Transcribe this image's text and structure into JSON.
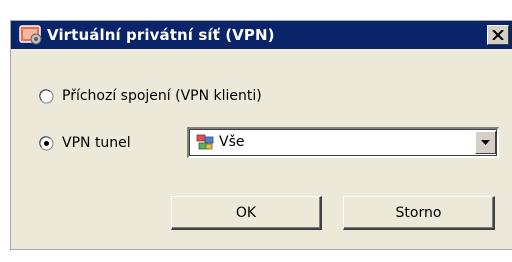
{
  "dialog": {
    "title": "Virtuální privátní síť (VPN)",
    "close_label": "×"
  },
  "options": {
    "incoming_label": "Příchozí spojení (VPN klienti)",
    "incoming_selected": false,
    "tunnel_label": "VPN tunel",
    "tunnel_selected": true
  },
  "tunnel_select": {
    "selected_value": "Vše",
    "icon": "network-group-icon"
  },
  "buttons": {
    "ok_label": "OK",
    "cancel_label": "Storno"
  }
}
